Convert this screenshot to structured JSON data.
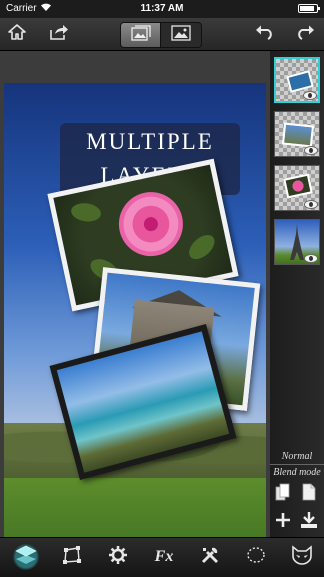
{
  "status_bar": {
    "carrier": "Carrier",
    "time": "11:37 AM",
    "battery_level": 0.85
  },
  "toolbar": {
    "home_icon": "home-icon",
    "share_icon": "share-icon",
    "view_modes": [
      "layers-view-icon",
      "image-view-icon"
    ],
    "active_view_mode": 0,
    "undo_icon": "undo-icon",
    "redo_icon": "redo-icon"
  },
  "canvas": {
    "title": "Multiple Layers"
  },
  "layers": [
    {
      "name": "layer-4",
      "active": true,
      "visible": true
    },
    {
      "name": "layer-3",
      "active": false,
      "visible": true
    },
    {
      "name": "layer-2",
      "active": false,
      "visible": true
    },
    {
      "name": "layer-1",
      "active": false,
      "visible": true
    }
  ],
  "blend": {
    "value": "Normal",
    "label": "Blend mode"
  },
  "side_tools": [
    "duplicate-layer-icon",
    "copy-layer-icon",
    "add-layer-icon",
    "merge-down-icon"
  ],
  "bottom_tools": [
    {
      "name": "layers-tool",
      "icon": "layers-icon",
      "active": true
    },
    {
      "name": "transform-tool",
      "icon": "transform-icon",
      "active": false
    },
    {
      "name": "adjust-tool",
      "icon": "gear-icon",
      "active": false
    },
    {
      "name": "fx-tool",
      "label": "Fx",
      "active": false
    },
    {
      "name": "tools-tool",
      "icon": "tools-icon",
      "active": false
    },
    {
      "name": "select-tool",
      "icon": "lasso-icon",
      "active": false
    },
    {
      "name": "mask-tool",
      "icon": "mask-icon",
      "active": false
    }
  ],
  "colors": {
    "accent": "#2fd0d8",
    "toolbar": "#2e2e2e",
    "panel": "#222222"
  }
}
